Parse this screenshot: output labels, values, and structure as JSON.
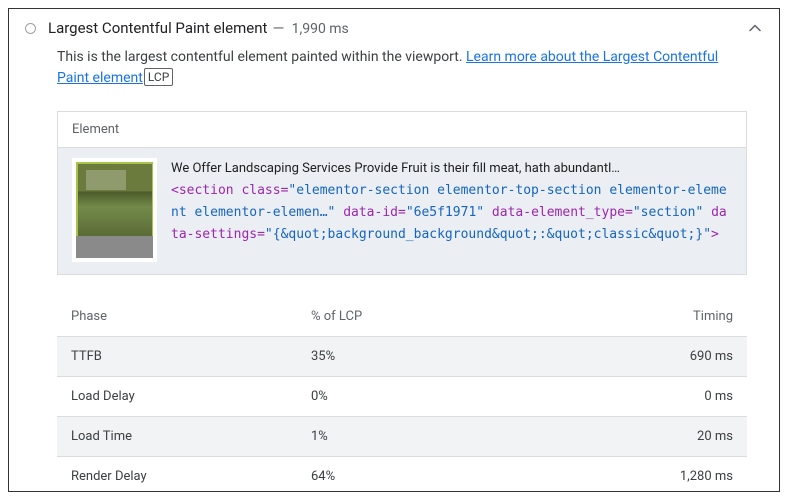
{
  "header": {
    "title": "Largest Contentful Paint element",
    "separator": "—",
    "timing": "1,990 ms"
  },
  "description": {
    "text": "This is the largest contentful element painted within the viewport. ",
    "link_text": "Learn more about the Largest Contentful Paint element",
    "badge": "LCP"
  },
  "element_panel": {
    "label": "Element",
    "text": "We Offer Landscaping Services Provide Fruit is their fill meat, hath abundantl…",
    "html_prefix": "<section ",
    "attr1_name": "class=",
    "attr1_val": "\"elementor-section elementor-top-section elementor-element elementor-elemen…\"",
    "attr2_name": " data-id=",
    "attr2_val": "\"6e5f1971\"",
    "attr3_name": " data-element_type=",
    "attr3_val": "\"section\"",
    "attr4_name": " data-settings=",
    "attr4_val": "\"{&quot;background_background&quot;:&quot;classic&quot;}\"",
    "html_suffix": ">"
  },
  "table": {
    "headers": {
      "phase": "Phase",
      "pct": "% of LCP",
      "timing": "Timing"
    },
    "rows": [
      {
        "phase": "TTFB",
        "pct": "35%",
        "timing": "690 ms"
      },
      {
        "phase": "Load Delay",
        "pct": "0%",
        "timing": "0 ms"
      },
      {
        "phase": "Load Time",
        "pct": "1%",
        "timing": "20 ms"
      },
      {
        "phase": "Render Delay",
        "pct": "64%",
        "timing": "1,280 ms"
      }
    ]
  }
}
